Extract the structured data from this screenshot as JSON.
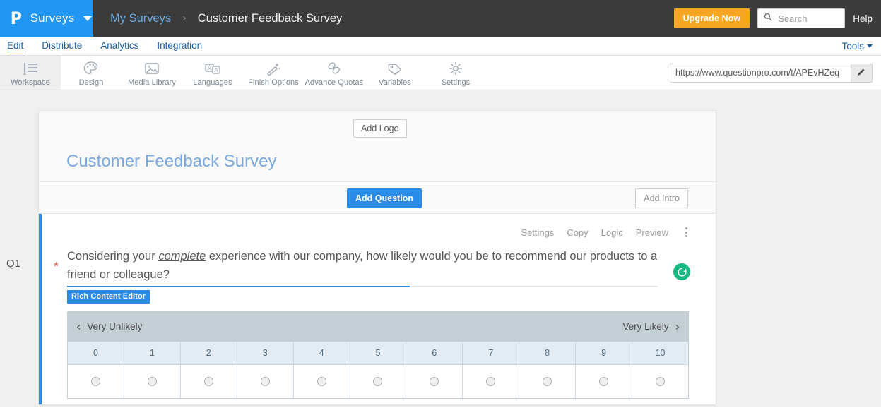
{
  "topbar": {
    "logo_icon": "questionpro-p-logo",
    "brand_label": "Surveys",
    "breadcrumb_parent": "My Surveys",
    "breadcrumb_separator": "›",
    "breadcrumb_current": "Customer Feedback Survey",
    "upgrade_label": "Upgrade Now",
    "search_placeholder": "Search",
    "search_value": "",
    "help_label": "Help",
    "bg_color": "#3b3b3b",
    "brand_color": "#2196f3",
    "upgrade_color": "#f5a623"
  },
  "nav": {
    "items": [
      {
        "label": "Edit",
        "active": true
      },
      {
        "label": "Distribute",
        "active": false
      },
      {
        "label": "Analytics",
        "active": false
      },
      {
        "label": "Integration",
        "active": false
      }
    ],
    "tools_label": "Tools",
    "link_color": "#1a5fa8"
  },
  "toolbar": {
    "items": [
      {
        "label": "Workspace",
        "icon": "workspace-icon",
        "active": true
      },
      {
        "label": "Design",
        "icon": "palette-icon",
        "active": false
      },
      {
        "label": "Media Library",
        "icon": "image-icon",
        "active": false
      },
      {
        "label": "Languages",
        "icon": "translate-icon",
        "active": false
      },
      {
        "label": "Finish Options",
        "icon": "magic-wand-icon",
        "active": false
      },
      {
        "label": "Advance Quotas",
        "icon": "link-chain-icon",
        "active": false
      },
      {
        "label": "Variables",
        "icon": "tag-icon",
        "active": false
      },
      {
        "label": "Settings",
        "icon": "gear-icon",
        "active": false
      }
    ],
    "survey_url": "https://www.questionpro.com/t/APEvHZeq",
    "edit_icon": "pencil-icon"
  },
  "survey_card": {
    "add_logo_label": "Add Logo",
    "title": "Customer Feedback Survey",
    "title_color": "#7ba9de",
    "add_question_label": "Add Question",
    "add_intro_label": "Add Intro"
  },
  "question": {
    "number_label": "Q1",
    "required_marker": "*",
    "actions": [
      "Settings",
      "Copy",
      "Logic",
      "Preview"
    ],
    "kebab_icon": "more-vertical-icon",
    "text_part1": "Considering your ",
    "text_emphasis": "complete",
    "text_part2": " experience with our company, how likely would you be to recommend our products to a friend or colleague?",
    "rich_content_badge": "Rich Content Editor",
    "grammar_icon": "grammarly-refresh-icon",
    "accent_color": "#2b8ce8"
  },
  "nps_scale": {
    "left_arrow": "‹",
    "right_arrow": "›",
    "left_label": "Very Unlikely",
    "right_label": "Very Likely",
    "values": [
      "0",
      "1",
      "2",
      "3",
      "4",
      "5",
      "6",
      "7",
      "8",
      "9",
      "10"
    ],
    "selected": null,
    "header_bg": "#c3ced5",
    "numbers_bg": "#e4ecf3"
  }
}
